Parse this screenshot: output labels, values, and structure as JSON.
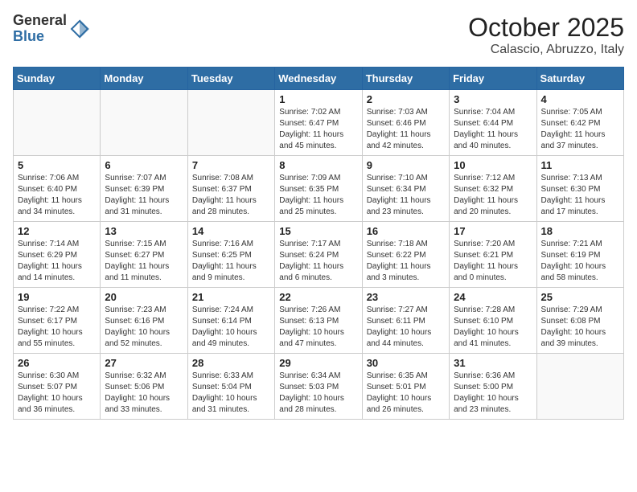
{
  "logo": {
    "general": "General",
    "blue": "Blue"
  },
  "title": "October 2025",
  "location": "Calascio, Abruzzo, Italy",
  "days_header": [
    "Sunday",
    "Monday",
    "Tuesday",
    "Wednesday",
    "Thursday",
    "Friday",
    "Saturday"
  ],
  "weeks": [
    [
      {
        "day": "",
        "info": ""
      },
      {
        "day": "",
        "info": ""
      },
      {
        "day": "",
        "info": ""
      },
      {
        "day": "1",
        "info": "Sunrise: 7:02 AM\nSunset: 6:47 PM\nDaylight: 11 hours and 45 minutes."
      },
      {
        "day": "2",
        "info": "Sunrise: 7:03 AM\nSunset: 6:46 PM\nDaylight: 11 hours and 42 minutes."
      },
      {
        "day": "3",
        "info": "Sunrise: 7:04 AM\nSunset: 6:44 PM\nDaylight: 11 hours and 40 minutes."
      },
      {
        "day": "4",
        "info": "Sunrise: 7:05 AM\nSunset: 6:42 PM\nDaylight: 11 hours and 37 minutes."
      }
    ],
    [
      {
        "day": "5",
        "info": "Sunrise: 7:06 AM\nSunset: 6:40 PM\nDaylight: 11 hours and 34 minutes."
      },
      {
        "day": "6",
        "info": "Sunrise: 7:07 AM\nSunset: 6:39 PM\nDaylight: 11 hours and 31 minutes."
      },
      {
        "day": "7",
        "info": "Sunrise: 7:08 AM\nSunset: 6:37 PM\nDaylight: 11 hours and 28 minutes."
      },
      {
        "day": "8",
        "info": "Sunrise: 7:09 AM\nSunset: 6:35 PM\nDaylight: 11 hours and 25 minutes."
      },
      {
        "day": "9",
        "info": "Sunrise: 7:10 AM\nSunset: 6:34 PM\nDaylight: 11 hours and 23 minutes."
      },
      {
        "day": "10",
        "info": "Sunrise: 7:12 AM\nSunset: 6:32 PM\nDaylight: 11 hours and 20 minutes."
      },
      {
        "day": "11",
        "info": "Sunrise: 7:13 AM\nSunset: 6:30 PM\nDaylight: 11 hours and 17 minutes."
      }
    ],
    [
      {
        "day": "12",
        "info": "Sunrise: 7:14 AM\nSunset: 6:29 PM\nDaylight: 11 hours and 14 minutes."
      },
      {
        "day": "13",
        "info": "Sunrise: 7:15 AM\nSunset: 6:27 PM\nDaylight: 11 hours and 11 minutes."
      },
      {
        "day": "14",
        "info": "Sunrise: 7:16 AM\nSunset: 6:25 PM\nDaylight: 11 hours and 9 minutes."
      },
      {
        "day": "15",
        "info": "Sunrise: 7:17 AM\nSunset: 6:24 PM\nDaylight: 11 hours and 6 minutes."
      },
      {
        "day": "16",
        "info": "Sunrise: 7:18 AM\nSunset: 6:22 PM\nDaylight: 11 hours and 3 minutes."
      },
      {
        "day": "17",
        "info": "Sunrise: 7:20 AM\nSunset: 6:21 PM\nDaylight: 11 hours and 0 minutes."
      },
      {
        "day": "18",
        "info": "Sunrise: 7:21 AM\nSunset: 6:19 PM\nDaylight: 10 hours and 58 minutes."
      }
    ],
    [
      {
        "day": "19",
        "info": "Sunrise: 7:22 AM\nSunset: 6:17 PM\nDaylight: 10 hours and 55 minutes."
      },
      {
        "day": "20",
        "info": "Sunrise: 7:23 AM\nSunset: 6:16 PM\nDaylight: 10 hours and 52 minutes."
      },
      {
        "day": "21",
        "info": "Sunrise: 7:24 AM\nSunset: 6:14 PM\nDaylight: 10 hours and 49 minutes."
      },
      {
        "day": "22",
        "info": "Sunrise: 7:26 AM\nSunset: 6:13 PM\nDaylight: 10 hours and 47 minutes."
      },
      {
        "day": "23",
        "info": "Sunrise: 7:27 AM\nSunset: 6:11 PM\nDaylight: 10 hours and 44 minutes."
      },
      {
        "day": "24",
        "info": "Sunrise: 7:28 AM\nSunset: 6:10 PM\nDaylight: 10 hours and 41 minutes."
      },
      {
        "day": "25",
        "info": "Sunrise: 7:29 AM\nSunset: 6:08 PM\nDaylight: 10 hours and 39 minutes."
      }
    ],
    [
      {
        "day": "26",
        "info": "Sunrise: 6:30 AM\nSunset: 5:07 PM\nDaylight: 10 hours and 36 minutes."
      },
      {
        "day": "27",
        "info": "Sunrise: 6:32 AM\nSunset: 5:06 PM\nDaylight: 10 hours and 33 minutes."
      },
      {
        "day": "28",
        "info": "Sunrise: 6:33 AM\nSunset: 5:04 PM\nDaylight: 10 hours and 31 minutes."
      },
      {
        "day": "29",
        "info": "Sunrise: 6:34 AM\nSunset: 5:03 PM\nDaylight: 10 hours and 28 minutes."
      },
      {
        "day": "30",
        "info": "Sunrise: 6:35 AM\nSunset: 5:01 PM\nDaylight: 10 hours and 26 minutes."
      },
      {
        "day": "31",
        "info": "Sunrise: 6:36 AM\nSunset: 5:00 PM\nDaylight: 10 hours and 23 minutes."
      },
      {
        "day": "",
        "info": ""
      }
    ]
  ]
}
